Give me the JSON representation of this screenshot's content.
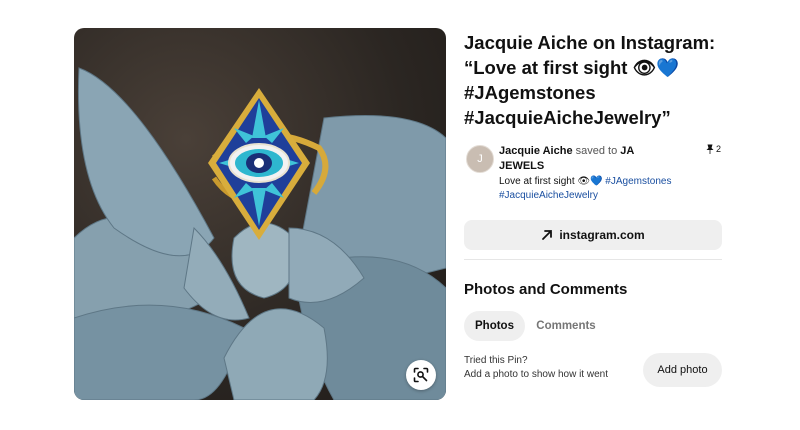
{
  "pin": {
    "title": "Jacquie Aiche on Instagram: “Love at first sight 👁💙 #JAgemstones #JacquieAicheJewelry”",
    "saver_name": "Jacquie Aiche",
    "saved_to_text": "saved to",
    "board_name": "JA JEWELS",
    "description_text": "Love at first sight 👁💙 ",
    "description_tags": [
      "#JAgemstones",
      "#JacquieAicheJewelry"
    ],
    "save_count": "2",
    "avatar_initial": "J",
    "link_label": "instagram.com"
  },
  "photos_comments": {
    "heading": "Photos and Comments",
    "tabs": [
      "Photos",
      "Comments"
    ],
    "tried_label": "Tried this Pin?",
    "tried_hint": "Add a photo to show how it went",
    "add_photo_label": "Add photo"
  },
  "icons": {
    "lens": "visual-search-icon",
    "link": "arrow-up-right-icon",
    "pin": "pushpin-icon"
  },
  "colors": {
    "link_tag": "#1a4fa0",
    "button_bg": "#efefef",
    "muted_text": "#767676"
  }
}
